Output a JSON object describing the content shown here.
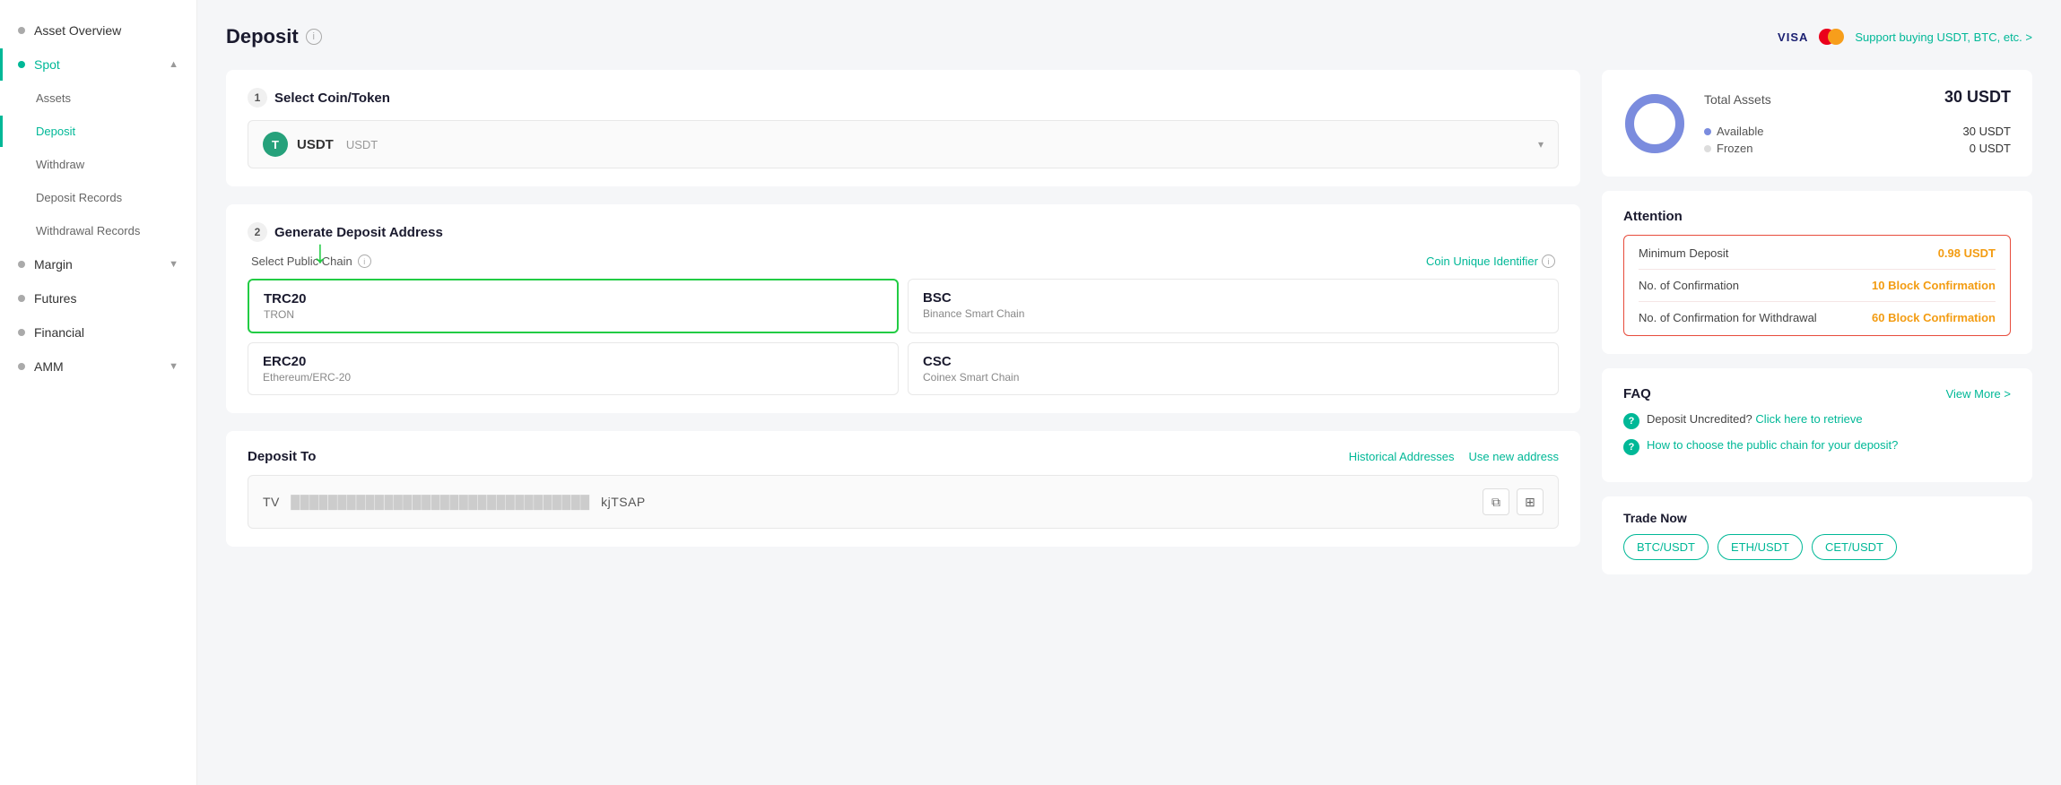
{
  "sidebar": {
    "items": [
      {
        "id": "asset-overview",
        "label": "Asset Overview",
        "level": "top",
        "active": false
      },
      {
        "id": "spot",
        "label": "Spot",
        "level": "parent",
        "active": true,
        "expanded": true
      },
      {
        "id": "assets",
        "label": "Assets",
        "level": "sub",
        "active": false
      },
      {
        "id": "deposit",
        "label": "Deposit",
        "level": "sub",
        "active": true
      },
      {
        "id": "withdraw",
        "label": "Withdraw",
        "level": "sub",
        "active": false
      },
      {
        "id": "deposit-records",
        "label": "Deposit Records",
        "level": "sub",
        "active": false
      },
      {
        "id": "withdrawal-records",
        "label": "Withdrawal Records",
        "level": "sub",
        "active": false
      },
      {
        "id": "margin",
        "label": "Margin",
        "level": "top",
        "active": false
      },
      {
        "id": "futures",
        "label": "Futures",
        "level": "top",
        "active": false
      },
      {
        "id": "financial",
        "label": "Financial",
        "level": "top",
        "active": false
      },
      {
        "id": "amm",
        "label": "AMM",
        "level": "top",
        "active": false
      }
    ]
  },
  "page": {
    "title": "Deposit",
    "support_text": "Support buying USDT, BTC, etc. >",
    "step1_label": "Select Coin/Token",
    "step2_label": "Generate Deposit Address",
    "select_chain_label": "Select Public Chain",
    "coin_identifier_label": "Coin Unique Identifier",
    "coin": {
      "icon": "T",
      "name": "USDT",
      "ticker": "USDT"
    },
    "chains": [
      {
        "id": "trc20",
        "code": "TRC20",
        "full": "TRON",
        "selected": true
      },
      {
        "id": "bsc",
        "code": "BSC",
        "full": "Binance Smart Chain",
        "selected": false
      },
      {
        "id": "erc20",
        "code": "ERC20",
        "full": "Ethereum/ERC-20",
        "selected": false
      },
      {
        "id": "csc",
        "code": "CSC",
        "full": "Coinex Smart Chain",
        "selected": false
      }
    ],
    "deposit_to": {
      "title": "Deposit To",
      "historical_link": "Historical Addresses",
      "new_address_link": "Use new address",
      "address_start": "TV",
      "address_end": "kjTSAP"
    }
  },
  "right_panel": {
    "total_assets": {
      "title": "Total Assets",
      "total": "30 USDT",
      "available_label": "Available",
      "available_val": "30 USDT",
      "frozen_label": "Frozen",
      "frozen_val": "0 USDT"
    },
    "attention": {
      "title": "Attention",
      "rows": [
        {
          "label": "Minimum Deposit",
          "value": "0.98 USDT"
        },
        {
          "label": "No. of Confirmation",
          "value": "10 Block Confirmation"
        },
        {
          "label": "No. of Confirmation for Withdrawal",
          "value": "60 Block Confirmation"
        }
      ]
    },
    "faq": {
      "title": "FAQ",
      "view_more": "View More >",
      "items": [
        {
          "text_prefix": "Deposit Uncredited?",
          "link": "Click here to retrieve"
        },
        {
          "text_prefix": "How to choose the public chain for your deposit?"
        }
      ]
    },
    "trade_now": {
      "title": "Trade Now",
      "pairs": [
        "BTC/USDT",
        "ETH/USDT",
        "CET/USDT"
      ]
    }
  }
}
